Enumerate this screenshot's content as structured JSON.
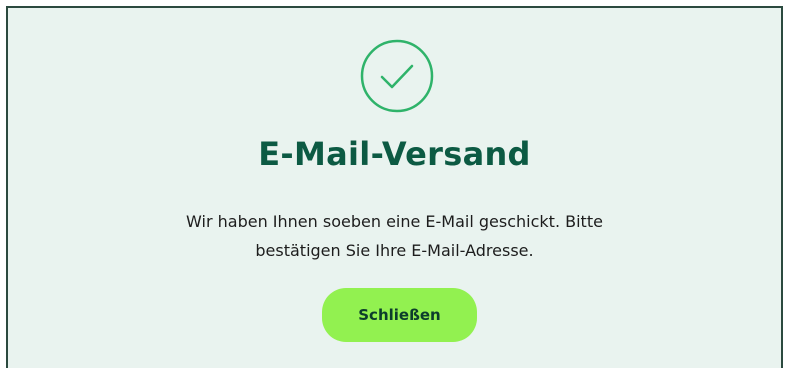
{
  "dialog": {
    "icon": "check-circle-icon",
    "title": "E-Mail-Versand",
    "message_line1": "Wir haben Ihnen soeben eine E-Mail geschickt. Bitte",
    "message_line2": "bestätigen Sie Ihre E-Mail-Adresse.",
    "close_label": "Schließen"
  },
  "colors": {
    "accent_green": "#2fb36a",
    "title_green": "#0c5a43",
    "button_green": "#92f150",
    "background": "#e9f3ef"
  }
}
